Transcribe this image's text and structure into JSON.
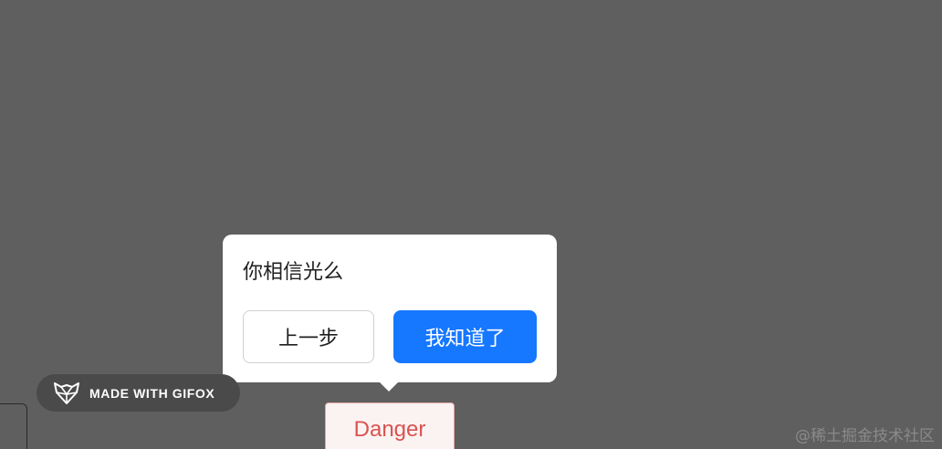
{
  "tour": {
    "title": "你相信光么",
    "prev_label": "上一步",
    "next_label": "我知道了"
  },
  "target": {
    "label": "Danger"
  },
  "badge": {
    "icon": "fox-icon",
    "text": "MADE WITH GIFOX"
  },
  "watermark": {
    "text": "@稀土掘金技术社区"
  },
  "colors": {
    "overlay": "#5f5f5f",
    "primary": "#1677ff",
    "danger": "#d9534f"
  }
}
